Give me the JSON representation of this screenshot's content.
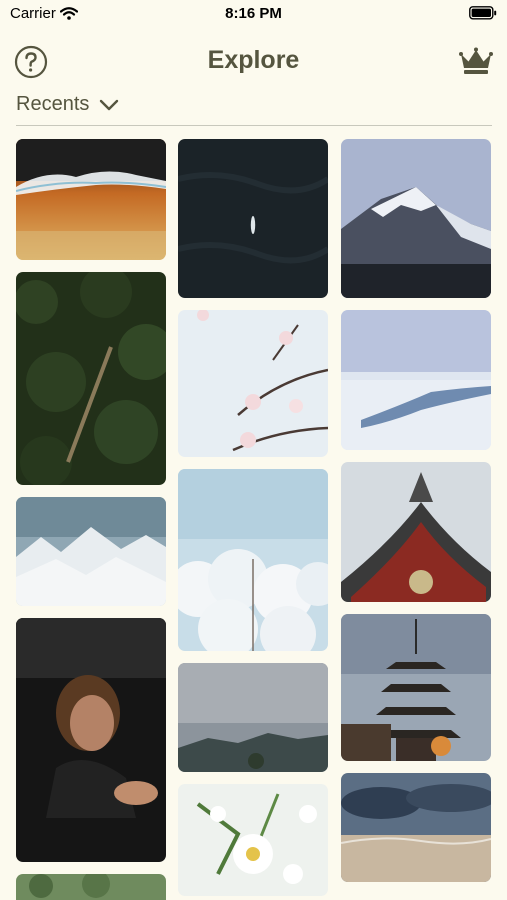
{
  "status_bar": {
    "carrier": "Carrier",
    "time": "8:16 PM"
  },
  "header": {
    "title": "Explore"
  },
  "album": {
    "label": "Recents"
  },
  "colors": {
    "background": "#fcfaee",
    "accent": "#55553f"
  },
  "icons": {
    "status": [
      "wifi-icon",
      "battery-icon"
    ],
    "header": [
      "help-icon",
      "crown-icon"
    ],
    "album": [
      "chevron-down-icon"
    ]
  }
}
